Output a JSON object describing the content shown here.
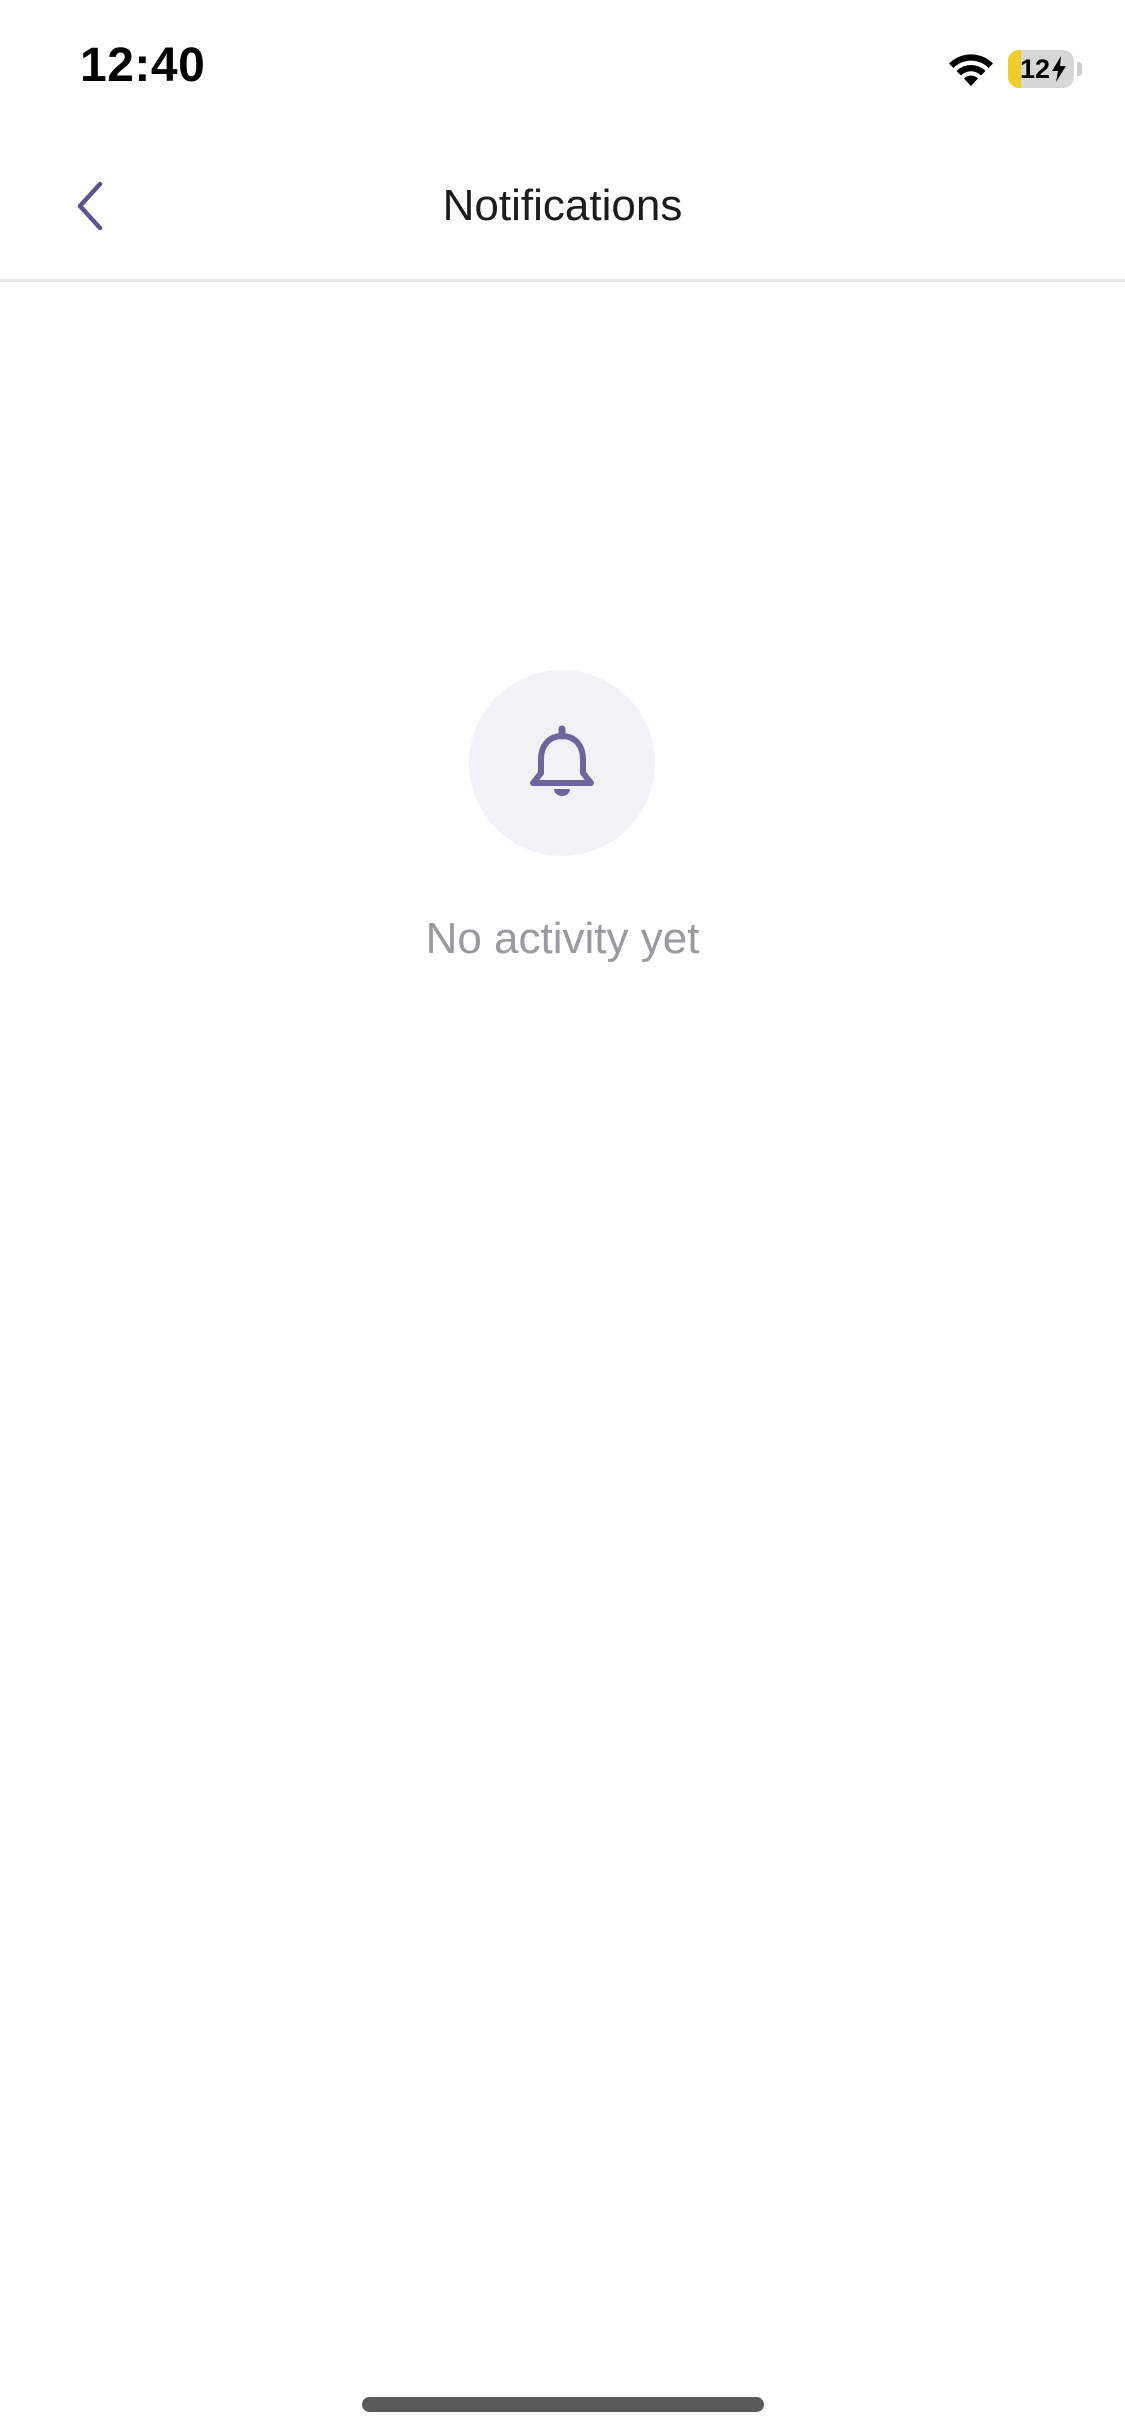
{
  "status_bar": {
    "time": "12:40",
    "battery_level": "12",
    "battery_fraction": 0.12,
    "battery_charging": true,
    "icons": [
      "wifi-icon",
      "battery-icon",
      "bolt-icon"
    ]
  },
  "nav": {
    "title": "Notifications",
    "back_icon": "chevron-left-icon"
  },
  "empty_state": {
    "icon": "bell-icon",
    "message": "No activity yet"
  },
  "colors": {
    "accent": "#5e538f",
    "icon_bg": "#f2f1f6",
    "muted_text": "#9a9a9e",
    "battery_low": "#f3cd27"
  }
}
